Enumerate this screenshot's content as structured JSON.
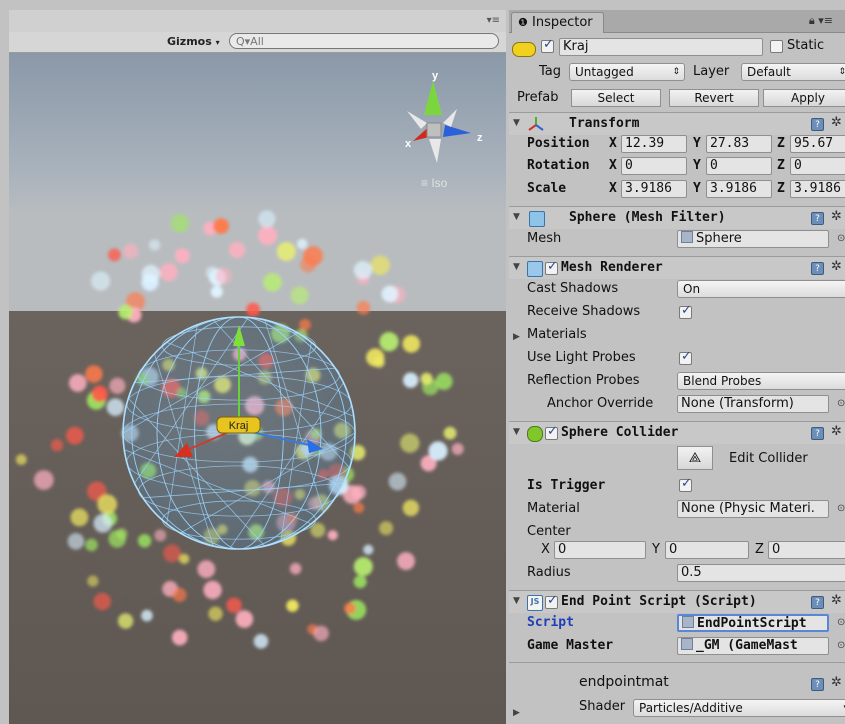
{
  "scene": {
    "menu_icon": "▾≡",
    "gizmos_label": "Gizmos",
    "search_placeholder": "Q▾All",
    "axis_y": "y",
    "axis_x": "x",
    "axis_z": "z",
    "view_mode": "≡ Iso",
    "object_label": "Kraj"
  },
  "inspector": {
    "tab_label": "Inspector",
    "tab_menu": "▾≡",
    "object": {
      "active": true,
      "name": "Kraj",
      "static_label": "Static",
      "tag_label": "Tag",
      "tag_value": "Untagged",
      "layer_label": "Layer",
      "layer_value": "Default",
      "prefab_label": "Prefab",
      "prefab_buttons": [
        "Select",
        "Revert",
        "Apply"
      ]
    },
    "transform": {
      "title": "Transform",
      "position_label": "Position",
      "rotation_label": "Rotation",
      "scale_label": "Scale",
      "position": {
        "x": "12.39",
        "y": "27.83",
        "z": "95.67"
      },
      "rotation": {
        "x": "0",
        "y": "0",
        "z": "0"
      },
      "scale": {
        "x": "3.9186",
        "y": "3.9186",
        "z": "3.9186"
      }
    },
    "mesh_filter": {
      "title": "Sphere (Mesh Filter)",
      "mesh_label": "Mesh",
      "mesh_value": "Sphere"
    },
    "mesh_renderer": {
      "title": "Mesh Renderer",
      "cast_shadows_label": "Cast Shadows",
      "cast_shadows_value": "On",
      "receive_shadows_label": "Receive Shadows",
      "materials_label": "Materials",
      "light_probes_label": "Use Light Probes",
      "reflection_probes_label": "Reflection Probes",
      "reflection_probes_value": "Blend Probes",
      "anchor_override_label": "Anchor Override",
      "anchor_override_value": "None (Transform)"
    },
    "sphere_collider": {
      "title": "Sphere Collider",
      "edit_button": "Edit Collider",
      "is_trigger_label": "Is Trigger",
      "material_label": "Material",
      "material_value": "None (Physic Materi.",
      "center_label": "Center",
      "center": {
        "x": "0",
        "y": "0",
        "z": "0"
      },
      "radius_label": "Radius",
      "radius_value": "0.5"
    },
    "script": {
      "title": "End Point Script (Script)",
      "script_label": "Script",
      "script_value": "EndPointScript",
      "game_master_label": "Game Master",
      "game_master_value": "_GM (GameMast"
    },
    "material": {
      "name": "endpointmat",
      "shader_label": "Shader",
      "shader_value": "Particles/Additive"
    }
  }
}
